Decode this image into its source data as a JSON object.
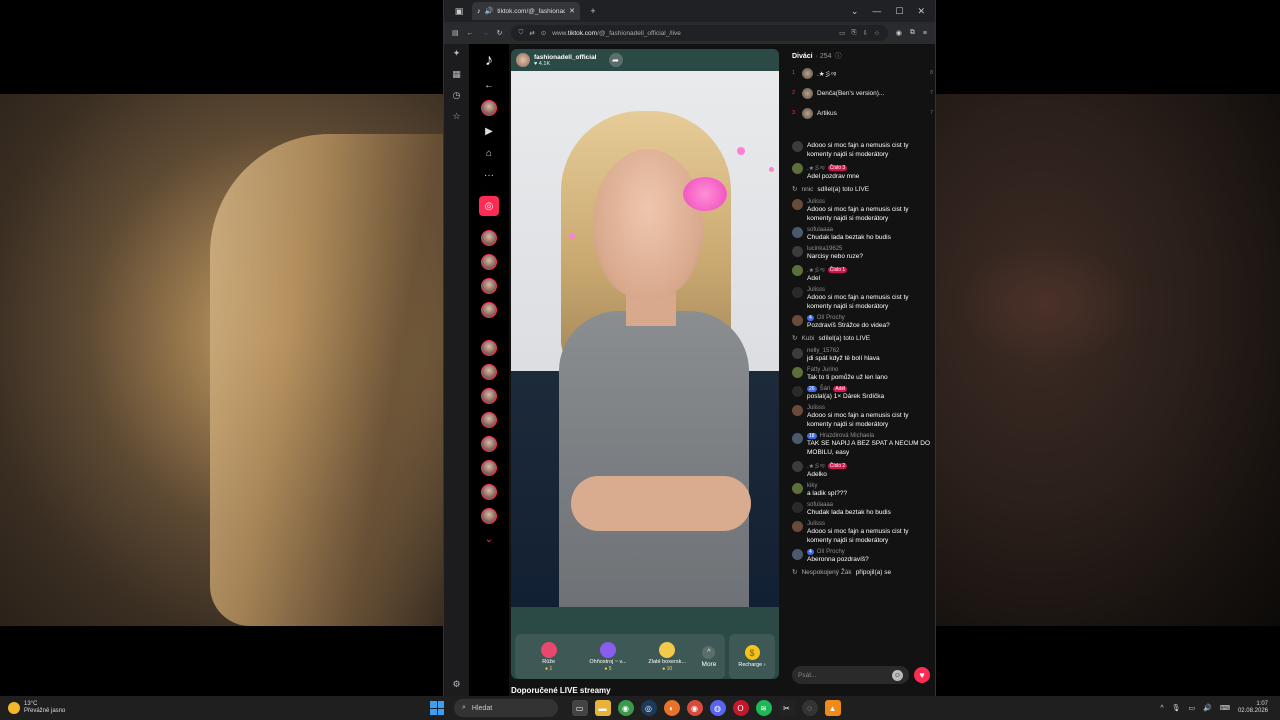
{
  "browser": {
    "tab_title": "tiktok.com/@_fashionadell",
    "url_prefix": "www.",
    "url_domain": "tiktok.com",
    "url_path": "/@_fashionadell_official_/live"
  },
  "stream": {
    "streamer_name": "fashionadell_official",
    "likes": "4.1K",
    "recommended_title": "Doporučené LIVE streamy"
  },
  "gifts": [
    {
      "name": "Růže",
      "price": "1",
      "color": "#e8486b"
    },
    {
      "name": "Ohňostroj ~ v...",
      "price": "5",
      "color": "#8a5cf0"
    },
    {
      "name": "Zlaté boxersk...",
      "price": "10",
      "color": "#f2c94c"
    }
  ],
  "more_label": "More",
  "recharge_label": "Recharge ›",
  "chat": {
    "header_title": "Diváci",
    "viewer_count": "· 254",
    "top_viewers": [
      {
        "rank": "1",
        "name": ".★彡ᵒᵍ",
        "score": "8"
      },
      {
        "rank": "2",
        "name": "Denča(Ben's version)...",
        "score": "7"
      },
      {
        "rank": "3",
        "name": "Artikus",
        "score": "7"
      }
    ],
    "messages": [
      {
        "user": "",
        "badge": "",
        "text": "Adooo si moc fajn a nemusis cist ty komenty najdi si moderátory"
      },
      {
        "user": ".★彡ᵒᵍ",
        "badge": "Číslo 3",
        "text": "Adel pozdrav mne"
      },
      {
        "system": true,
        "user": "nnic",
        "text": "sdílel(a) toto LIVE"
      },
      {
        "user": "Julisss",
        "badge": "",
        "text": "Adooo si moc fajn a nemusis cist ty komenty najdi si moderátory"
      },
      {
        "user": "sofulaaaa",
        "badge": "",
        "text": "Chudak lada beztak ho budis"
      },
      {
        "user": "lucinka19625",
        "badge": "",
        "text": "Narcisy nebo ruze?"
      },
      {
        "user": ".★彡ᵒᵍ",
        "badge": "Číslo 1",
        "text": "Adel"
      },
      {
        "user": "Julisss",
        "badge": "",
        "text": "Adooo si moc fajn a nemusis cist ty komenty najdi si moderátory"
      },
      {
        "user": "Olí Prochy",
        "badge": "",
        "level": "4",
        "text": "Pozdravíš Strážce do videa?"
      },
      {
        "system": true,
        "user": "Kubi",
        "text": "sdílel(a) toto LIVE"
      },
      {
        "user": "nelly_15762",
        "badge": "",
        "text": "jdi spát když tě bolí hlava"
      },
      {
        "user": "Fatty Jurino",
        "badge": "",
        "text": "Tak to ti pomůže už len lano"
      },
      {
        "user": "Šári",
        "badge": "Adél",
        "level": "26",
        "text": "poslal(a) 1× Dárek Srdíčka"
      },
      {
        "user": "Julisss",
        "badge": "",
        "text": "Adooo si moc fajn a nemusis cist ty komenty najdi si moderátory"
      },
      {
        "user": "Hrazdirová Michaela",
        "badge": "",
        "level": "18",
        "text": "TAK SE NAPIJ A BEZ SPAT A NECUM DO MOBILU, easy"
      },
      {
        "user": ".★彡ᵒᵍ",
        "badge": "Číslo 2",
        "text": "Adelko"
      },
      {
        "user": "kiky",
        "badge": "",
        "text": "a ladik spí???"
      },
      {
        "user": "sofulaaaa",
        "badge": "",
        "text": "Chudak lada beztak ho budis"
      },
      {
        "user": "Julisss",
        "badge": "",
        "text": "Adooo si moc fajn a nemusis cist ty komenty najdi si moderátory"
      },
      {
        "user": "Olí Prochy",
        "badge": "",
        "level": "4",
        "text": "Aberonna pozdravíš?"
      },
      {
        "system": true,
        "user": "Nespokojený Žák",
        "text": "připojil(a) se"
      }
    ],
    "input_placeholder": "Psát..."
  },
  "taskbar": {
    "temp": "13°C",
    "weather": "Převážně jasno",
    "search_label": "Hledat",
    "time": "1:07",
    "date": "02.08.2026"
  }
}
